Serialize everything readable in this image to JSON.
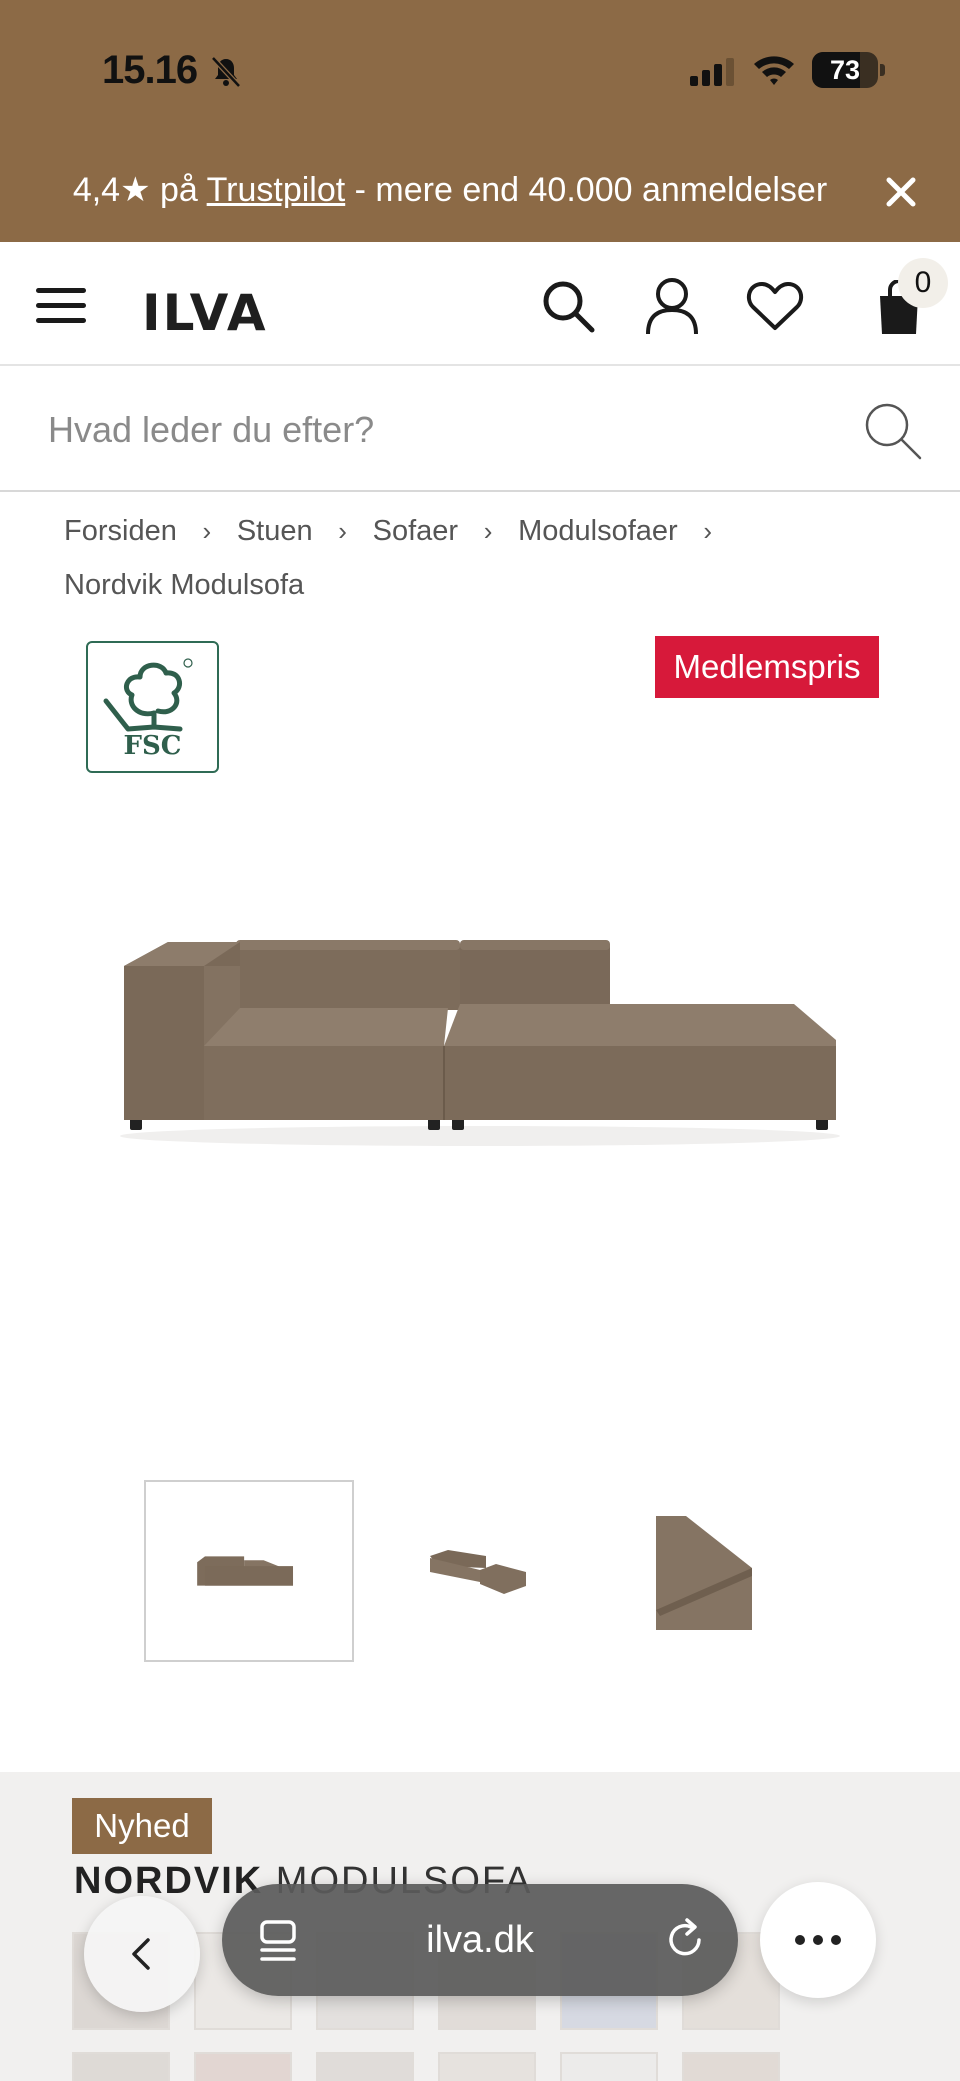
{
  "status_bar": {
    "time": "15.16",
    "battery_level": "73",
    "battery_fraction": 0.73
  },
  "promo": {
    "rating": "4,4★ på ",
    "link_text": "Trustpilot",
    "rest": " - mere end 40.000 anmeldelser"
  },
  "header": {
    "logo": "ILVA",
    "cart_count": "0"
  },
  "search": {
    "placeholder": "Hvad leder du efter?"
  },
  "breadcrumb": {
    "items": [
      "Forsiden",
      "Stuen",
      "Sofaer",
      "Modulsofaer",
      "Nordvik Modulsofa"
    ],
    "separator": "›"
  },
  "badges": {
    "fsc": "FSC",
    "member_price": "Medlemspris"
  },
  "product": {
    "new_label": "Nyhed",
    "name_bold": "NORDVIK",
    "name_rest": " MODULSOFA"
  },
  "browser": {
    "address": "ilva.dk"
  },
  "colors": {
    "brand_brown": "#8c6a46",
    "member_red": "#d7193a",
    "fsc_green": "#2f6b55",
    "sofa_taupe": "#857463"
  },
  "icons": [
    "bell-slash-icon",
    "signal-icon",
    "wifi-icon",
    "close-icon",
    "menu-icon",
    "search-icon",
    "account-icon",
    "heart-icon",
    "cart-icon",
    "tree-icon",
    "chevron-left-icon",
    "tabs-icon",
    "reload-icon",
    "more-icon"
  ]
}
